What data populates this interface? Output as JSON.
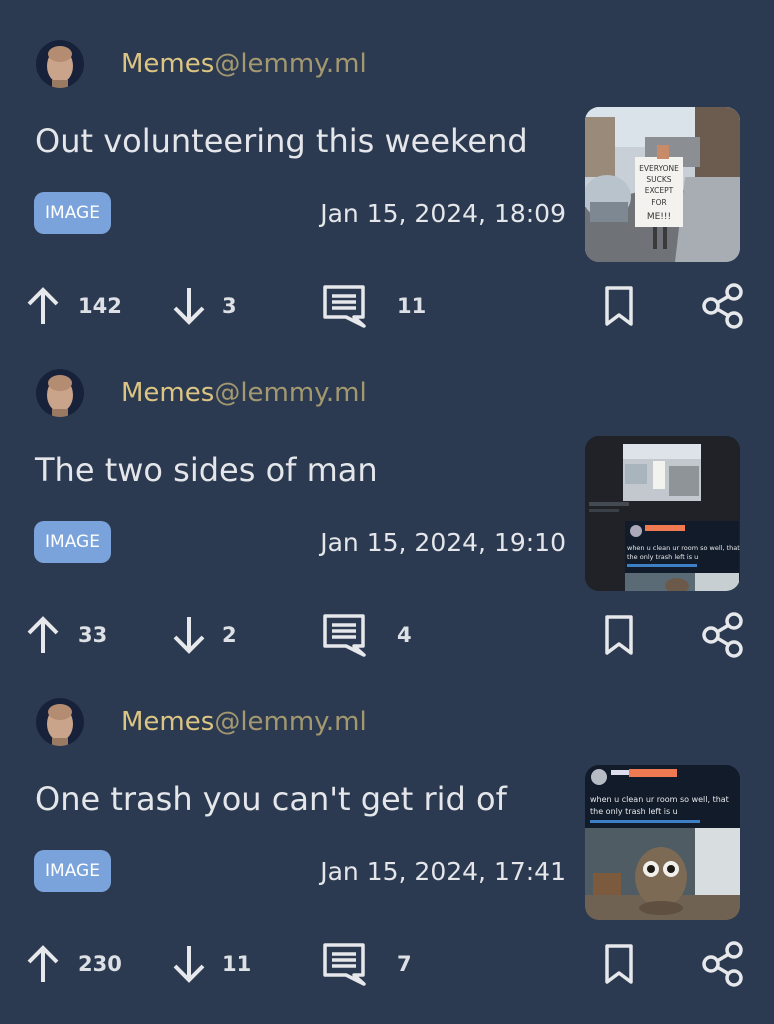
{
  "posts": [
    {
      "community": "Memes",
      "instance": "@lemmy.ml",
      "title": "Out volunteering this weekend",
      "badge": "IMAGE",
      "date": "Jan 15, 2024, 18:09",
      "upvotes": "142",
      "downvotes": "3",
      "comments": "11",
      "thumbnail_text": [
        "EVERYONE",
        "SUCKS",
        "EXCEPT",
        "FOR",
        "ME!!!"
      ]
    },
    {
      "community": "Memes",
      "instance": "@lemmy.ml",
      "title": "The two sides of man",
      "badge": "IMAGE",
      "date": "Jan 15, 2024, 19:10",
      "upvotes": "33",
      "downvotes": "2",
      "comments": "4",
      "thumbnail_text": [
        "when u clean ur room so well, that",
        "the only trash left is u"
      ]
    },
    {
      "community": "Memes",
      "instance": "@lemmy.ml",
      "title": "One trash you can't get rid of",
      "badge": "IMAGE",
      "date": "Jan 15, 2024, 17:41",
      "upvotes": "230",
      "downvotes": "11",
      "comments": "7",
      "thumbnail_text": [
        "when u clean ur room so well, that",
        "the only trash left is u"
      ]
    }
  ],
  "icons": {
    "avatar": "meme-man-avatar",
    "upvote": "arrow-up-icon",
    "downvote": "arrow-down-icon",
    "comments": "comment-icon",
    "bookmark": "bookmark-icon",
    "share": "share-icon"
  },
  "colors": {
    "background": "#2b3a50",
    "community": "#dcc583",
    "badge": "#7ba3db",
    "text": "#e4e6ea"
  }
}
